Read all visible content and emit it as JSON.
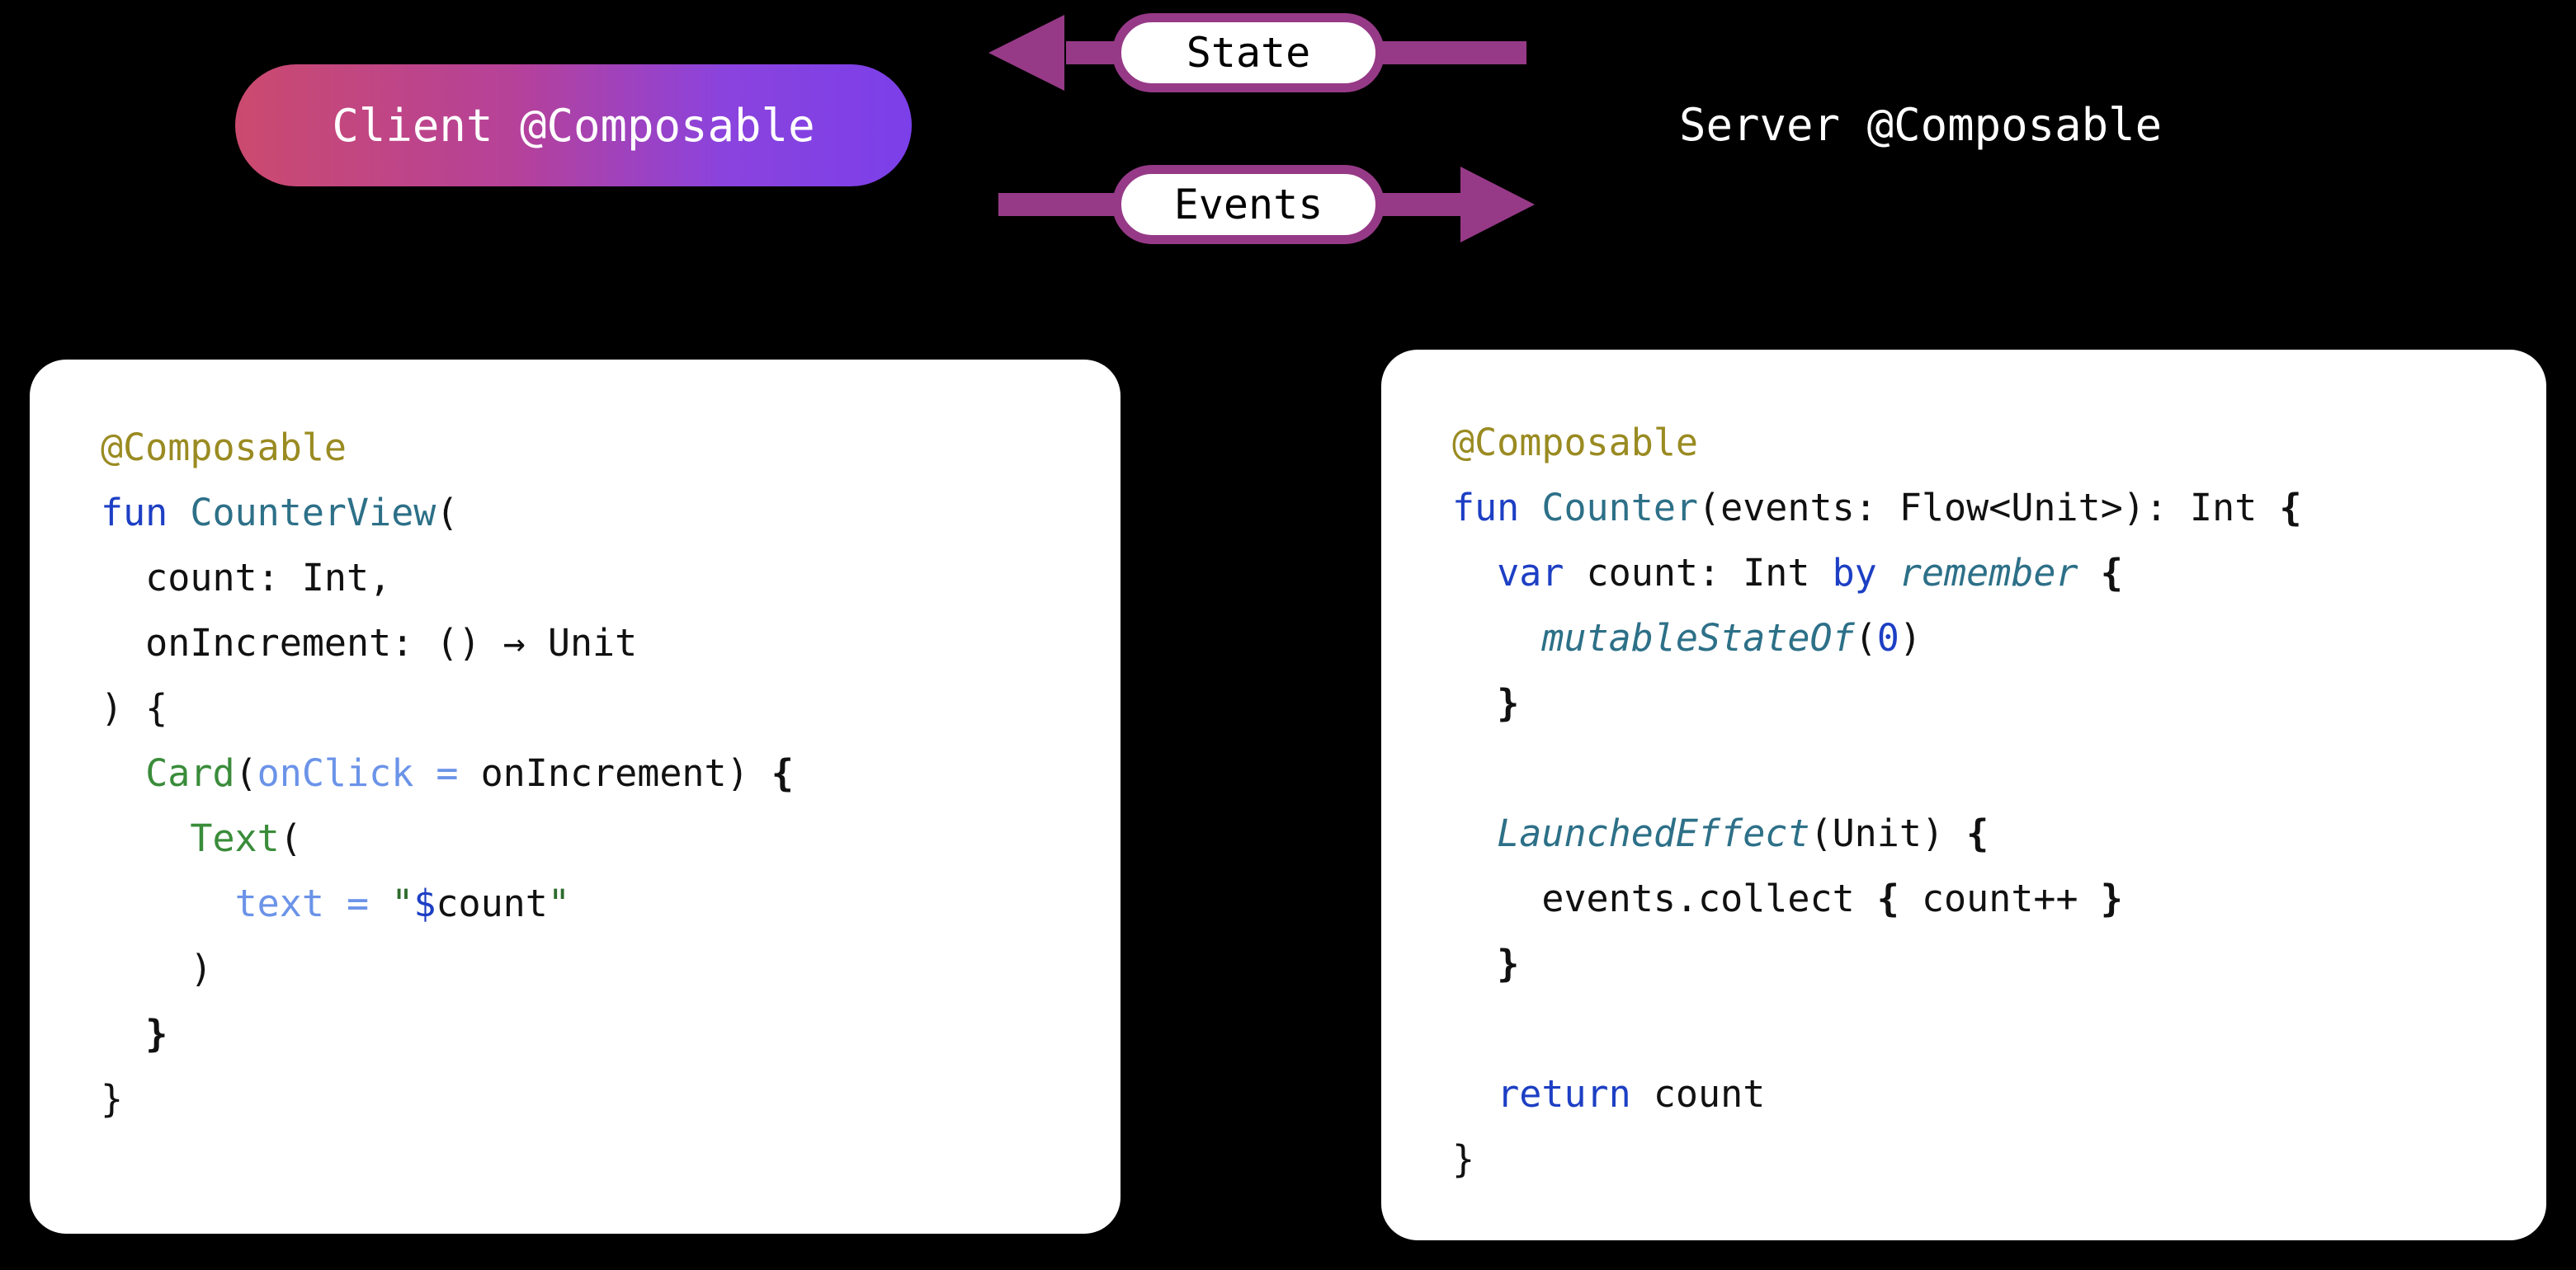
{
  "colors": {
    "background": "#000000",
    "card_bg": "#ffffff",
    "arrow": "#963a87",
    "pill_gradient_start": "#cb4a6e",
    "pill_gradient_end": "#7b3fe9",
    "annotation": "#9a8b22",
    "keyword": "#1d3fc4",
    "function_name": "#2d7088",
    "call": "#3a8c3a",
    "param": "#6b93e8",
    "string": "#2d6b2d"
  },
  "top": {
    "client_pill_label": "Client @Composable",
    "server_label": "Server @Composable",
    "flow": {
      "state_label": "State",
      "events_label": "Events"
    }
  },
  "client_code": {
    "lines": [
      [
        {
          "t": "@Composable",
          "c": "tok-ann"
        }
      ],
      [
        {
          "t": "fun ",
          "c": "tok-kw"
        },
        {
          "t": "CounterView",
          "c": "tok-fnname"
        },
        {
          "t": "(",
          "c": "tok-plain"
        }
      ],
      [
        {
          "t": "  count: Int,",
          "c": "tok-plain"
        }
      ],
      [
        {
          "t": "  onIncrement: () → Unit",
          "c": "tok-plain"
        }
      ],
      [
        {
          "t": ") {",
          "c": "tok-plain"
        }
      ],
      [
        {
          "t": "  ",
          "c": "tok-plain"
        },
        {
          "t": "Card",
          "c": "tok-call"
        },
        {
          "t": "(",
          "c": "tok-plain"
        },
        {
          "t": "onClick =",
          "c": "tok-param"
        },
        {
          "t": " onIncrement) ",
          "c": "tok-plain"
        },
        {
          "t": "{",
          "c": "tok-brace"
        }
      ],
      [
        {
          "t": "    ",
          "c": "tok-plain"
        },
        {
          "t": "Text",
          "c": "tok-call"
        },
        {
          "t": "(",
          "c": "tok-plain"
        }
      ],
      [
        {
          "t": "      ",
          "c": "tok-plain"
        },
        {
          "t": "text =",
          "c": "tok-param"
        },
        {
          "t": " ",
          "c": "tok-plain"
        },
        {
          "t": "\"",
          "c": "tok-str"
        },
        {
          "t": "$",
          "c": "tok-tmpl"
        },
        {
          "t": "count",
          "c": "tok-plain"
        },
        {
          "t": "\"",
          "c": "tok-str"
        }
      ],
      [
        {
          "t": "    )",
          "c": "tok-plain"
        }
      ],
      [
        {
          "t": "  ",
          "c": "tok-plain"
        },
        {
          "t": "}",
          "c": "tok-brace"
        }
      ],
      [
        {
          "t": "}",
          "c": "tok-plain"
        }
      ]
    ]
  },
  "server_code": {
    "lines": [
      [
        {
          "t": "@Composable",
          "c": "tok-ann"
        }
      ],
      [
        {
          "t": "fun ",
          "c": "tok-kw"
        },
        {
          "t": "Counter",
          "c": "tok-fnname"
        },
        {
          "t": "(events: Flow<Unit>): Int ",
          "c": "tok-plain"
        },
        {
          "t": "{",
          "c": "tok-brace"
        }
      ],
      [
        {
          "t": "  ",
          "c": "tok-plain"
        },
        {
          "t": "var",
          "c": "tok-kw"
        },
        {
          "t": " count: Int ",
          "c": "tok-plain"
        },
        {
          "t": "by",
          "c": "tok-kw"
        },
        {
          "t": " ",
          "c": "tok-plain"
        },
        {
          "t": "remember",
          "c": "tok-ital"
        },
        {
          "t": " ",
          "c": "tok-plain"
        },
        {
          "t": "{",
          "c": "tok-brace"
        }
      ],
      [
        {
          "t": "    ",
          "c": "tok-plain"
        },
        {
          "t": "mutableStateOf",
          "c": "tok-ital"
        },
        {
          "t": "(",
          "c": "tok-plain"
        },
        {
          "t": "0",
          "c": "tok-num"
        },
        {
          "t": ")",
          "c": "tok-plain"
        }
      ],
      [
        {
          "t": "  ",
          "c": "tok-plain"
        },
        {
          "t": "}",
          "c": "tok-brace"
        }
      ],
      [
        {
          "t": "",
          "c": "tok-plain"
        }
      ],
      [
        {
          "t": "  ",
          "c": "tok-plain"
        },
        {
          "t": "LaunchedEffect",
          "c": "tok-ital"
        },
        {
          "t": "(Unit) ",
          "c": "tok-plain"
        },
        {
          "t": "{",
          "c": "tok-brace"
        }
      ],
      [
        {
          "t": "    events.collect ",
          "c": "tok-plain"
        },
        {
          "t": "{",
          "c": "tok-brace"
        },
        {
          "t": " count++ ",
          "c": "tok-plain"
        },
        {
          "t": "}",
          "c": "tok-brace"
        }
      ],
      [
        {
          "t": "  ",
          "c": "tok-plain"
        },
        {
          "t": "}",
          "c": "tok-brace"
        }
      ],
      [
        {
          "t": "",
          "c": "tok-plain"
        }
      ],
      [
        {
          "t": "  ",
          "c": "tok-plain"
        },
        {
          "t": "return",
          "c": "tok-kw"
        },
        {
          "t": " count",
          "c": "tok-plain"
        }
      ],
      [
        {
          "t": "}",
          "c": "tok-plain"
        }
      ]
    ]
  }
}
